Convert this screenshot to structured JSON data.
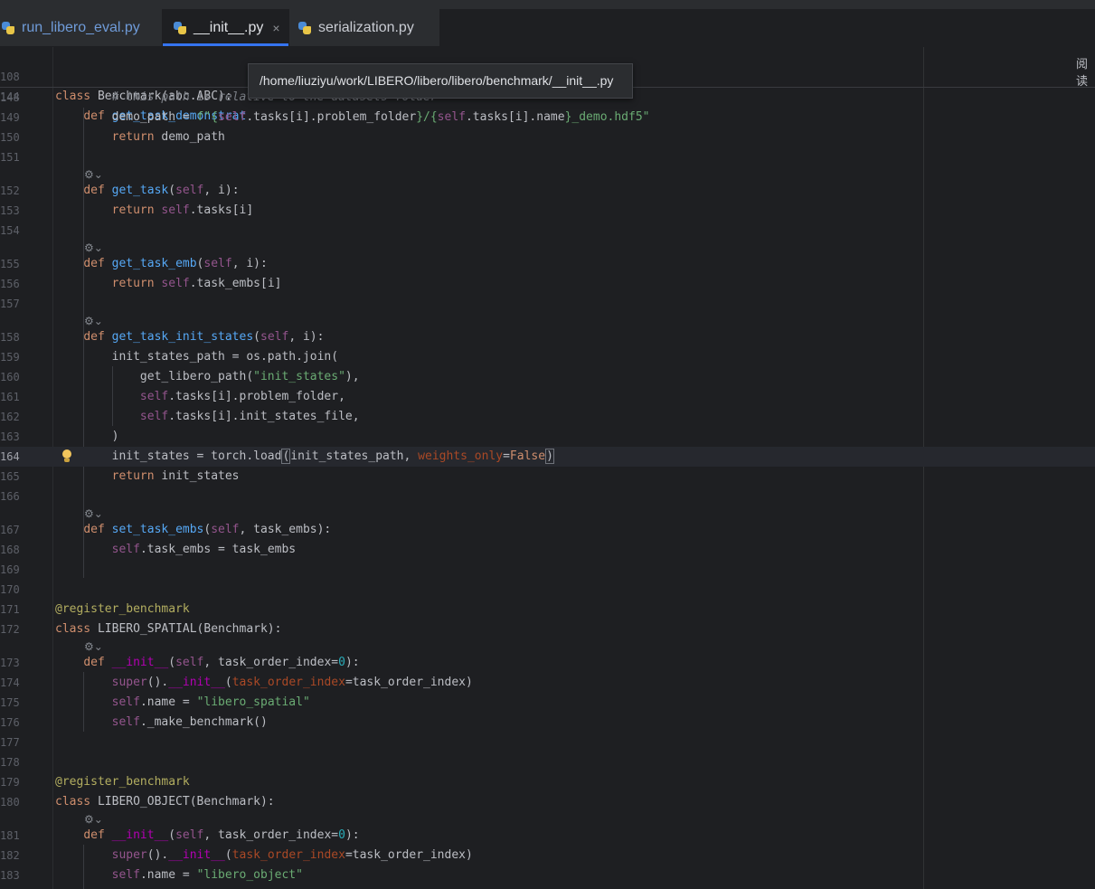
{
  "tabs": [
    {
      "label": "run_libero_eval.py",
      "active": false
    },
    {
      "label": "__init__.py",
      "active": true,
      "close": "×"
    },
    {
      "label": "serialization.py",
      "active": false
    }
  ],
  "tooltip": "/home/liuziyu/work/LIBERO/libero/libero/benchmark/__init__.py",
  "reader_mode_label": "阅读",
  "sticky_lines": [
    {
      "num": "108",
      "text": "class Benchmark(abc.ABC):"
    },
    {
      "num": "144",
      "text": "    def get_task_demonstrat"
    }
  ],
  "line_numbers": [
    "148",
    "149",
    "150",
    "151",
    "152",
    "153",
    "154",
    "155",
    "156",
    "157",
    "158",
    "159",
    "160",
    "161",
    "162",
    "163",
    "164",
    "165",
    "166",
    "167",
    "168",
    "169",
    "170",
    "171",
    "172",
    "173",
    "174",
    "175",
    "176",
    "177",
    "178",
    "179",
    "180",
    "181",
    "182",
    "183"
  ],
  "code_lines": [
    "        # this path is relative to the datasets folder",
    "        demo_path = f\"{self.tasks[i].problem_folder}/{self.tasks[i].name}_demo.hdf5\"",
    "        return demo_path",
    "",
    "    def get_task(self, i):",
    "        return self.tasks[i]",
    "",
    "    def get_task_emb(self, i):",
    "        return self.task_embs[i]",
    "",
    "    def get_task_init_states(self, i):",
    "        init_states_path = os.path.join(",
    "            get_libero_path(\"init_states\"),",
    "            self.tasks[i].problem_folder,",
    "            self.tasks[i].init_states_file,",
    "        )",
    "        init_states = torch.load(init_states_path, weights_only=False)",
    "        return init_states",
    "",
    "    def set_task_embs(self, task_embs):",
    "        self.task_embs = task_embs",
    "",
    "",
    "@register_benchmark",
    "class LIBERO_SPATIAL(Benchmark):",
    "    def __init__(self, task_order_index=0):",
    "        super().__init__(task_order_index=task_order_index)",
    "        self.name = \"libero_spatial\"",
    "        self._make_benchmark()",
    "",
    "",
    "@register_benchmark",
    "class LIBERO_OBJECT(Benchmark):",
    "    def __init__(self, task_order_index=0):",
    "        super().__init__(task_order_index=task_order_index)",
    "        self.name = \"libero_object\""
  ],
  "inlay_hint": "⚙⌄",
  "colors": {
    "keyword": "#cf8e6d",
    "function": "#56a8f5",
    "string": "#6aab73",
    "self": "#94558d",
    "number": "#2aacb8",
    "decorator": "#b3ae60",
    "accent": "#3574f0"
  }
}
